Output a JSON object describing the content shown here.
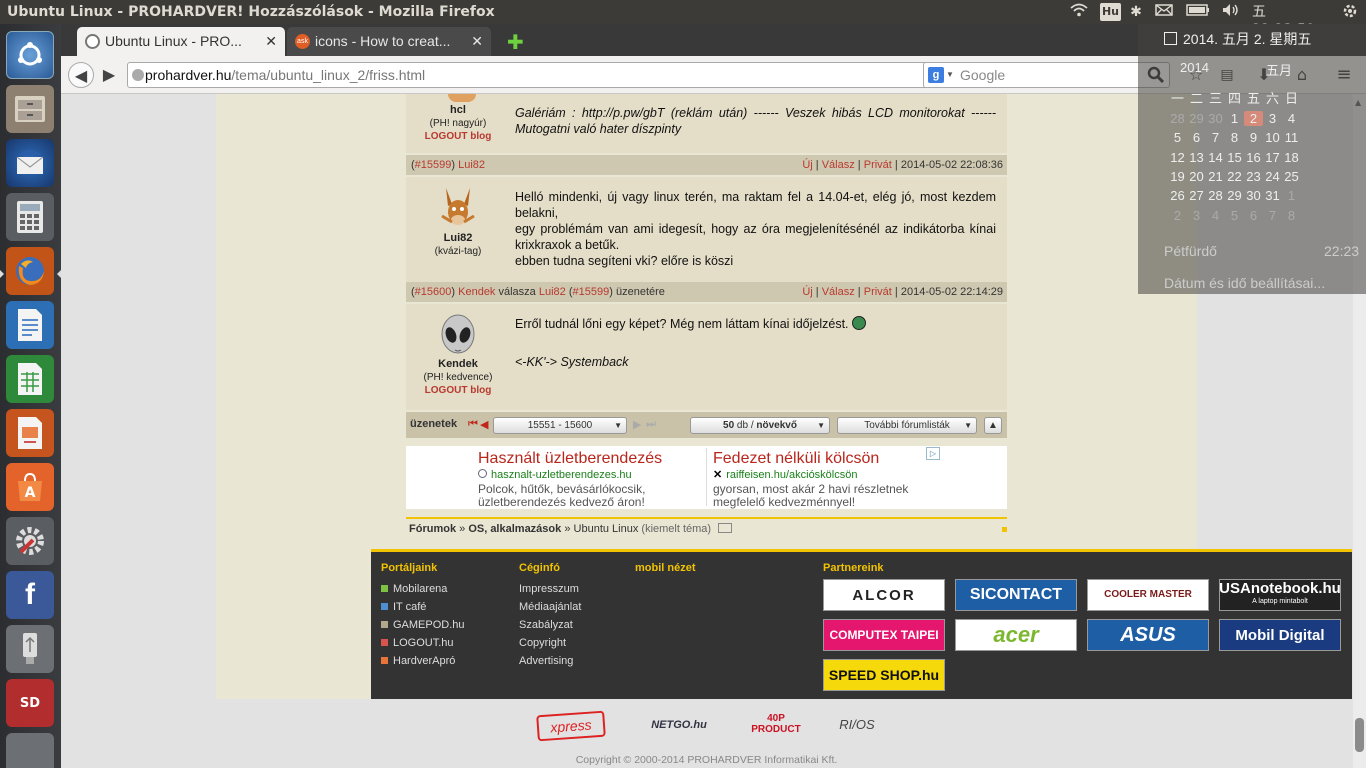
{
  "topbar": {
    "window_title": "Ubuntu Linux - PROHARDVER! Hozzászólások - Mozilla Firefox",
    "keyboard_layout": "Hu",
    "clock": "五 22:23:59"
  },
  "launcher": {
    "items": [
      "Dash home",
      "Files",
      "Thunderbird",
      "Calculator",
      "Firefox",
      "Writer",
      "Calc",
      "Impress",
      "Software Center",
      "System Settings",
      "Facebook",
      "USB drive",
      "SD card",
      "Trash"
    ]
  },
  "tabs": [
    {
      "label": "Ubuntu Linux - PRO...",
      "active": true
    },
    {
      "label": "icons - How to creat...",
      "active": false
    }
  ],
  "navbar": {
    "url_host": "prohardver.hu",
    "url_path": "/tema/ubuntu_linux_2/friss.html",
    "search_placeholder": "Google",
    "search_engine_letter": "g"
  },
  "posts": [
    {
      "author": "hcl",
      "rank": "(PH! nagyúr)",
      "blog": "LOGOUT blog",
      "text": "Galériám : http://p.pw/gbT (reklám után) ------ Veszek hibás LCD monitorokat ------ Mutogatni való hater díszpinty"
    },
    {
      "id": "#15599",
      "author": "Lui82",
      "rank": "(kvázi-tag)",
      "blog": "",
      "actions": [
        "Új",
        "Válasz",
        "Privát"
      ],
      "date": "2014-05-02 22:08:36",
      "text_lines": [
        "Helló mindenki, új vagy linux terén, ma raktam fel a 14.04-et, elég jó, most kezdem belakni,",
        "egy problémám van ami idegesít, hogy az óra megjelenítésénél az indikátorba kínai krixkraxok a betűk.",
        "ebben tudna segíteni vki? előre is köszi"
      ]
    },
    {
      "id": "#15600",
      "author": "Kendek",
      "reply_word": "válasza",
      "reply_to_author": "Lui82",
      "reply_to_id": "#15599",
      "reply_suffix": "üzenetére",
      "rank": "(PH! kedvence)",
      "blog": "LOGOUT blog",
      "actions": [
        "Új",
        "Válasz",
        "Privát"
      ],
      "date": "2014-05-02 22:14:29",
      "text": "Erről tudnál lőni egy képet? Még nem láttam kínai időjelzést.",
      "signature": "<-KK'-> Systemback"
    }
  ],
  "pagination": {
    "label": "üzenetek",
    "range": "15551 - 15600",
    "per_page_count": "50",
    "per_page_unit": "db /",
    "order": "növekvő",
    "more_lists": "További fórumlisták"
  },
  "ads": [
    {
      "title": "Használt üzletberendezés",
      "url": "hasznalt-uzletberendezes.hu",
      "desc": "Polcok, hűtők, bevásárlókocsik, üzletberendezés kedvező áron!"
    },
    {
      "title": "Fedezet nélküli kölcsön",
      "url": "raiffeisen.hu/akcióskölcsön",
      "desc": "gyorsan, most akár 2 havi részletnek megfelelő kedvezménnyel!"
    }
  ],
  "breadcrumb": {
    "items": [
      "Fórumok",
      "OS, alkalmazások",
      "Ubuntu Linux"
    ],
    "note": "(kiemelt téma)"
  },
  "footer": {
    "col1_title": "Portáljaink",
    "col1_items": [
      "Mobilarena",
      "IT café",
      "GAMEPOD.hu",
      "LOGOUT.hu",
      "HardverApró"
    ],
    "col1_colors": [
      "#7dc242",
      "#4f8fd0",
      "#b0a88a",
      "#d9534f",
      "#e8743b"
    ],
    "col2_title": "Céginfó",
    "col2_items": [
      "Impresszum",
      "Médiaajánlat",
      "Szabályzat",
      "Copyright",
      "Advertising"
    ],
    "col3_title": "mobil nézet",
    "partners_title": "Partnereink",
    "partners": [
      "ALCOR",
      "SICONTACT",
      "COOLER MASTER",
      "USAnotebook.hu",
      "COMPUTEX TAIPEI",
      "acer",
      "ASUS",
      "Mobil Digital",
      "SPEED SHOP.hu"
    ],
    "usanotebook_sub": "A laptop mintabolt"
  },
  "bottom": {
    "logos": [
      "xpress",
      "NETGO.hu",
      "40P PRODUCT",
      "RI/OS"
    ],
    "copyright": "Copyright © 2000-2014 PROHARDVER Informatikai Kft."
  },
  "calendar": {
    "header": "2014. 五月  2. 星期五",
    "nav_year": "2014",
    "nav_month": "五月",
    "weekdays": [
      "一",
      "二",
      "三",
      "四",
      "五",
      "六",
      "日"
    ],
    "weeks": [
      [
        "28",
        "29",
        "30",
        "1",
        "2",
        "3",
        "4"
      ],
      [
        "5",
        "6",
        "7",
        "8",
        "9",
        "10",
        "11"
      ],
      [
        "12",
        "13",
        "14",
        "15",
        "16",
        "17",
        "18"
      ],
      [
        "19",
        "20",
        "21",
        "22",
        "23",
        "24",
        "25"
      ],
      [
        "26",
        "27",
        "28",
        "29",
        "30",
        "31",
        "1"
      ],
      [
        "2",
        "3",
        "4",
        "5",
        "6",
        "7",
        "8"
      ]
    ],
    "event_name": "Pétfürdő",
    "event_time": "22:23",
    "settings_link": "Dátum és idő beállításai..."
  }
}
